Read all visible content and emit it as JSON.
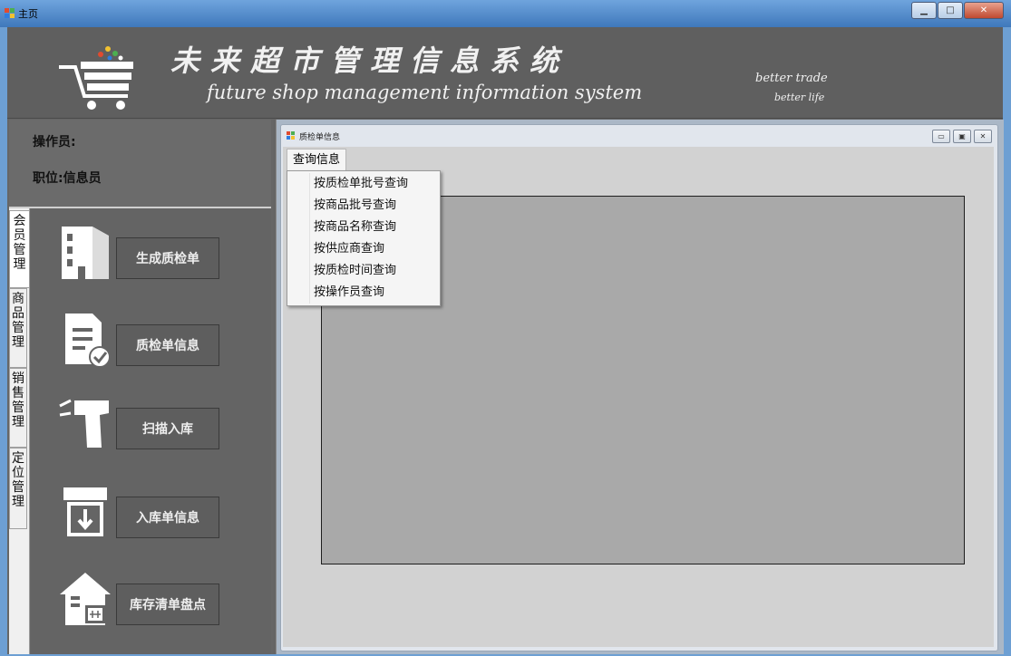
{
  "window": {
    "title": "主页"
  },
  "header": {
    "title_cn": "未来超市管理信息系统",
    "title_en": "future shop management information system",
    "slogan_1": "better trade",
    "slogan_2": "better life"
  },
  "operator": {
    "name_label": "操作员:",
    "position_label": "职位:信息员"
  },
  "side_tabs": [
    {
      "label": "会员管理"
    },
    {
      "label": "商品管理"
    },
    {
      "label": "销售管理"
    },
    {
      "label": "定位管理"
    }
  ],
  "nav_buttons": [
    {
      "label": "生成质检单",
      "icon": "building-icon"
    },
    {
      "label": "质检单信息",
      "icon": "document-check-icon"
    },
    {
      "label": "扫描入库",
      "icon": "scanner-icon"
    },
    {
      "label": "入库单信息",
      "icon": "inbox-download-icon"
    },
    {
      "label": "库存清单盘点",
      "icon": "warehouse-icon"
    }
  ],
  "child_window": {
    "title": "质检单信息",
    "menu_label": "查询信息",
    "menu_items": [
      "按质检单批号查询",
      "按商品批号查询",
      "按商品名称查询",
      "按供应商查询",
      "按质检时间查询",
      "按操作员查询"
    ]
  },
  "colors": {
    "header_bg": "#5f5f5f",
    "panel_bg": "#656565",
    "mdi_bg": "#aab7c6",
    "inner_panel": "#a9a9a9"
  }
}
